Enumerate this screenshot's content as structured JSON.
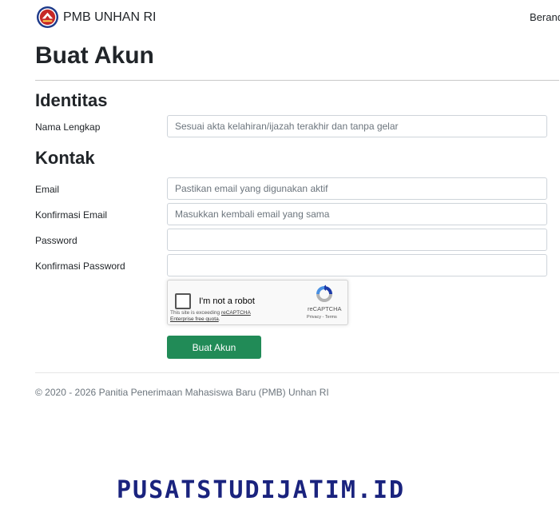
{
  "navbar": {
    "brand": "PMB UNHAN RI",
    "link": "Beranda"
  },
  "page_title": "Buat Akun",
  "sections": {
    "identitas": {
      "title": "Identitas",
      "nama_label": "Nama Lengkap",
      "nama_placeholder": "Sesuai akta kelahiran/ijazah terakhir dan tanpa gelar"
    },
    "kontak": {
      "title": "Kontak",
      "email_label": "Email",
      "email_placeholder": "Pastikan email yang digunakan aktif",
      "konf_email_label": "Konfirmasi Email",
      "konf_email_placeholder": "Masukkan kembali email yang sama",
      "password_label": "Password",
      "konf_password_label": "Konfirmasi Password"
    }
  },
  "captcha": {
    "label": "I'm not a robot",
    "quota_prefix": "This site is exceeding ",
    "quota_link": "reCAPTCHA Enterprise free quota",
    "quota_suffix": ".",
    "brand": "reCAPTCHA",
    "links": "Privacy - Terms",
    "colors": {
      "blue": "#1c3aa9",
      "light": "#4a90e2",
      "gray": "#b3b3b3"
    }
  },
  "submit_label": "Buat Akun",
  "footer": "© 2020 - 2026 Panitia Penerimaan Mahasiswa Baru (PMB) Unhan RI",
  "watermark": "PUSATSTUDIJATIM.ID",
  "colors": {
    "submit": "#218b57",
    "watermark": "#1a237e",
    "logo_red": "#c62828",
    "logo_blue": "#1e3a8a"
  },
  "icons": {
    "brand": "unhan-emblem-icon",
    "captcha": "recaptcha-logo-icon"
  }
}
